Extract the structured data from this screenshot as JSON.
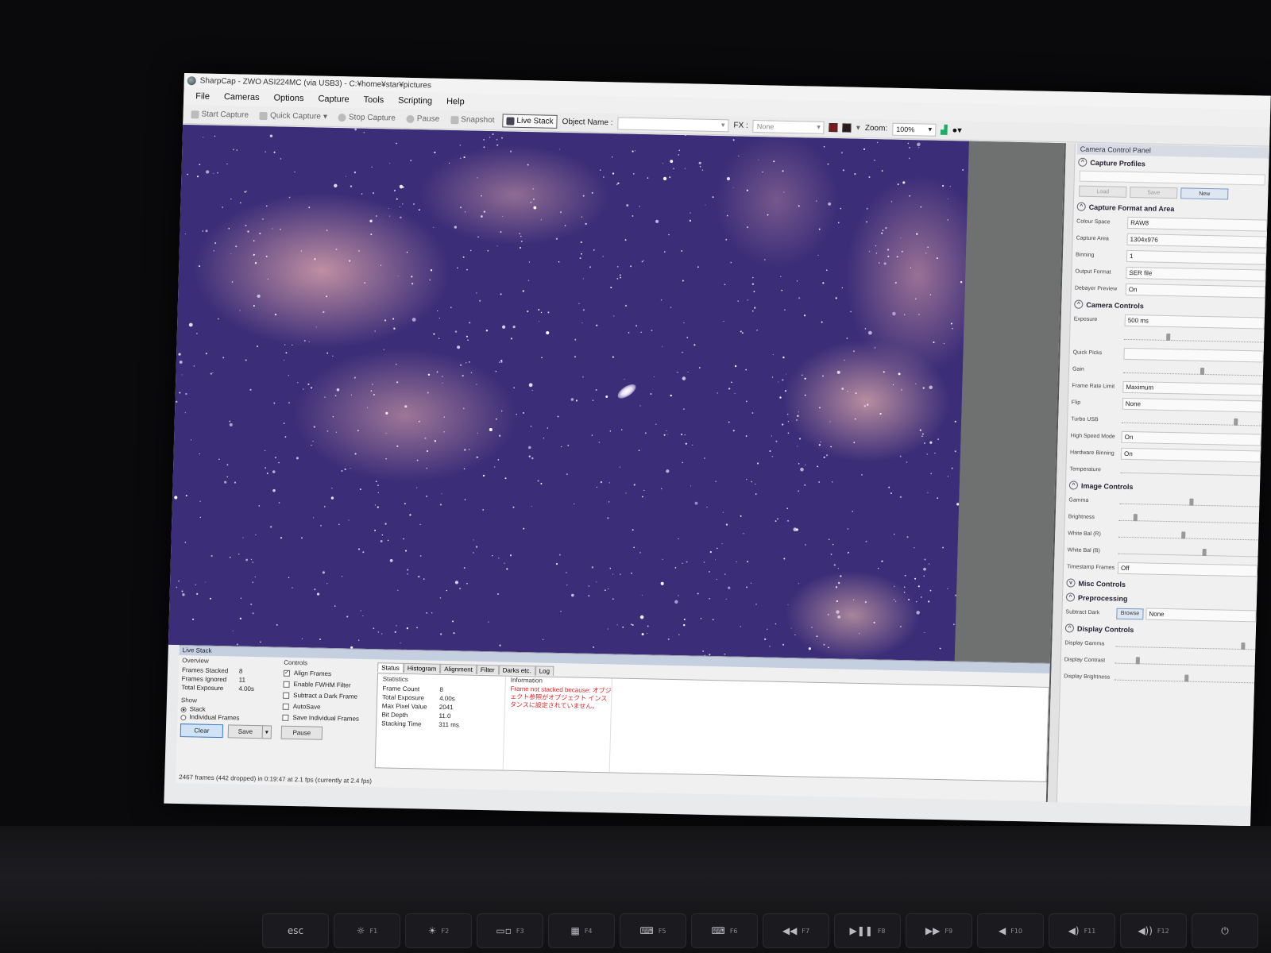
{
  "window": {
    "title": "SharpCap - ZWO ASI224MC (via USB3) - C:¥home¥star¥pictures"
  },
  "menu": [
    "File",
    "Cameras",
    "Options",
    "Capture",
    "Tools",
    "Scripting",
    "Help"
  ],
  "toolbar": {
    "start_capture": "Start Capture",
    "quick_capture": "Quick Capture",
    "stop_capture": "Stop Capture",
    "pause": "Pause",
    "snapshot": "Snapshot",
    "live_stack": "Live Stack",
    "object_name_label": "Object Name :",
    "fx_label": "FX :",
    "fx_value": "None",
    "zoom_label": "Zoom:",
    "zoom_value": "100%"
  },
  "camera_panel": {
    "title": "Camera Control Panel",
    "capture_profiles": {
      "heading": "Capture Profiles",
      "load": "Load",
      "save": "Save",
      "new": "New"
    },
    "capture_format": {
      "heading": "Capture Format and Area",
      "rows": [
        {
          "label": "Colour Space",
          "value": "RAW8"
        },
        {
          "label": "Capture Area",
          "value": "1304x976"
        },
        {
          "label": "Binning",
          "value": "1"
        },
        {
          "label": "Output Format",
          "value": "SER file"
        },
        {
          "label": "Debayer Preview",
          "value": "On"
        }
      ]
    },
    "camera_controls": {
      "heading": "Camera Controls",
      "exposure_label": "Exposure",
      "exposure_value": "500 ms",
      "quick_picks_label": "Quick Picks",
      "gain_label": "Gain",
      "frame_rate_label": "Frame Rate Limit",
      "frame_rate_value": "Maximum",
      "flip_label": "Flip",
      "flip_value": "None",
      "turbo_label": "Turbo USB",
      "high_speed_label": "High Speed Mode",
      "high_speed_value": "On",
      "hw_binning_label": "Hardware Binning",
      "hw_binning_value": "On",
      "temperature_label": "Temperature"
    },
    "image_controls": {
      "heading": "Image Controls",
      "gamma": "Gamma",
      "brightness": "Brightness",
      "wb_r": "White Bal (R)",
      "wb_b": "White Bal (B)",
      "timestamp_label": "Timestamp Frames",
      "timestamp_value": "Off"
    },
    "misc_controls": {
      "heading": "Misc Controls"
    },
    "preprocessing": {
      "heading": "Preprocessing",
      "subtract_dark": "Subtract Dark",
      "browse": "Browse",
      "dark_value": "None"
    },
    "display_controls": {
      "heading": "Display Controls",
      "gamma": "Display Gamma",
      "contrast": "Display Contrast",
      "brightness": "Display Brightness"
    }
  },
  "live_stack": {
    "title": "Live Stack",
    "overview": {
      "heading": "Overview",
      "frames_stacked_label": "Frames Stacked",
      "frames_stacked": "8",
      "frames_ignored_label": "Frames Ignored",
      "frames_ignored": "11",
      "total_exposure_label": "Total Exposure",
      "total_exposure": "4.00s"
    },
    "show": {
      "heading": "Show",
      "stack": "Stack",
      "individual": "Individual Frames"
    },
    "controls": {
      "heading": "Controls",
      "align": "Align Frames",
      "fwhm": "Enable FWHM Filter",
      "dark": "Subtract a Dark Frame",
      "autosave": "AutoSave",
      "save_individual": "Save Individual Frames"
    },
    "buttons": {
      "clear": "Clear",
      "save": "Save",
      "pause": "Pause"
    },
    "tabs": [
      "Status",
      "Histogram",
      "Alignment",
      "Filter",
      "Darks etc.",
      "Log"
    ],
    "statistics": {
      "heading": "Statistics",
      "rows": [
        {
          "k": "Frame Count",
          "v": "8"
        },
        {
          "k": "Total Exposure",
          "v": "4.00s"
        },
        {
          "k": "Max Pixel Value",
          "v": "2041"
        },
        {
          "k": "Bit Depth",
          "v": "11.0"
        },
        {
          "k": "Stacking Time",
          "v": "311 ms"
        }
      ]
    },
    "information": {
      "heading": "Information",
      "message": "Frame not stacked because: オブジェクト参照がオブジェクト インスタンスに設定されていません。"
    }
  },
  "status_bar": "2467 frames (442 dropped) in 0:19:47 at 2.1 fps  (currently at 2.4 fps)",
  "keyboard": {
    "keys": [
      {
        "label": "esc",
        "fn": ""
      },
      {
        "label": "☼",
        "fn": "F1"
      },
      {
        "label": "☀",
        "fn": "F2"
      },
      {
        "label": "▭▫",
        "fn": "F3"
      },
      {
        "label": "▦",
        "fn": "F4"
      },
      {
        "label": "⌨",
        "fn": "F5"
      },
      {
        "label": "⌨",
        "fn": "F6"
      },
      {
        "label": "◀◀",
        "fn": "F7"
      },
      {
        "label": "▶❚❚",
        "fn": "F8"
      },
      {
        "label": "▶▶",
        "fn": "F9"
      },
      {
        "label": "◀",
        "fn": "F10"
      },
      {
        "label": "◀)",
        "fn": "F11"
      },
      {
        "label": "◀))",
        "fn": "F12"
      },
      {
        "label": "⏻",
        "fn": ""
      }
    ]
  }
}
